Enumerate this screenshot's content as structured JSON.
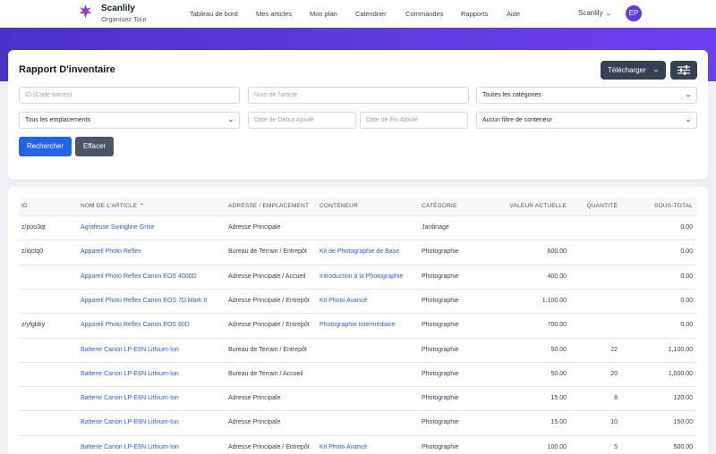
{
  "nav": {
    "brand_name": "Scanlily",
    "brand_subtitle": "Organisez Tout",
    "items": [
      {
        "label": "Tableau de bord"
      },
      {
        "label": "Mes articles"
      },
      {
        "label": "Mon plan"
      },
      {
        "label": "Calendrier"
      },
      {
        "label": "Commandes"
      },
      {
        "label": "Rapports"
      },
      {
        "label": "Aide"
      }
    ],
    "user_name": "Scanlily",
    "avatar_initials": "EP"
  },
  "colors": {
    "accent": "#2563eb",
    "band_gradient": [
      "#4b33c8",
      "#6a3ff0"
    ],
    "dark_button": "#374151"
  },
  "report": {
    "title": "Rapport D'inventaire",
    "download_label": "Télécharger",
    "filters_icon": "sliders-icon",
    "filters": {
      "id_placeholder": "ID (Code-barres)",
      "name_placeholder": "Nom de l'article",
      "category_value": "Toutes les catégories",
      "location_value": "Tous les emplacements",
      "start_date_placeholder": "Date de Début Ajouté",
      "end_date_placeholder": "Date de Fin Ajouté",
      "container_value": "Aucun filtre de conteneur"
    },
    "search_label": "Rechercher",
    "clear_label": "Effacer"
  },
  "table": {
    "headers": {
      "id": "ID",
      "name": "NOM DE L'ARTICLE",
      "address": "ADRESSE / EMPLACEMENT",
      "container": "CONTENEUR",
      "category": "CATÉGORIE",
      "value": "VALEUR ACTUELLE",
      "quantity": "QUANTITÉ",
      "subtotal": "SOUS-TOTAL"
    },
    "sort_column": "name",
    "rows": [
      {
        "id": "z/poo3qt",
        "name": "Agrafeuse Swingline Grise",
        "address": "Adresse Principale",
        "container": "",
        "category": "Jardinage",
        "value": "",
        "quantity": "",
        "subtotal": "0.00"
      },
      {
        "id": "z/iqctq0",
        "name": "Appareil Photo Reflex",
        "address": "Bureau de Terrain / Entrepôt",
        "container": "Kit de Photographie de Base",
        "category": "Photographie",
        "value": "600.00",
        "quantity": "",
        "subtotal": "0.00"
      },
      {
        "id": "",
        "name": "Appareil Photo Reflex Canon EOS 4000D",
        "address": "Adresse Principale / Accueil",
        "container": "Introduction à la Photographie",
        "category": "Photographie",
        "value": "400.00",
        "quantity": "",
        "subtotal": "0.00"
      },
      {
        "id": "",
        "name": "Appareil Photo Reflex Canon EOS 7D Mark II",
        "address": "Adresse Principale / Entrepôt",
        "container": "Kit Photo Avancé",
        "category": "Photographie",
        "value": "1,100.00",
        "quantity": "",
        "subtotal": "0.00"
      },
      {
        "id": "z/yfgbby",
        "name": "Appareil Photo Reflex Canon EOS 80D",
        "address": "Adresse Principale / Entrepôt",
        "container": "Photographie Intermédiaire",
        "category": "Photographie",
        "value": "700.00",
        "quantity": "",
        "subtotal": "0.00"
      },
      {
        "id": "",
        "name": "Batterie Canon LP-E6N Lithium-Ion",
        "address": "Bureau de Terrain / Entrepôt",
        "container": "",
        "category": "Photographie",
        "value": "50.00",
        "quantity": "22",
        "subtotal": "1,100.00"
      },
      {
        "id": "",
        "name": "Batterie Canon LP-E6N Lithium-Ion",
        "address": "Bureau de Terrain / Accueil",
        "container": "",
        "category": "Photographie",
        "value": "50.00",
        "quantity": "20",
        "subtotal": "1,000.00"
      },
      {
        "id": "",
        "name": "Batterie Canon LP-E6N Lithium-Ion",
        "address": "Adresse Principale",
        "container": "",
        "category": "Photographie",
        "value": "15.00",
        "quantity": "8",
        "subtotal": "120.00"
      },
      {
        "id": "",
        "name": "Batterie Canon LP-E6N Lithium-Ion",
        "address": "Adresse Principale",
        "container": "",
        "category": "Photographie",
        "value": "15.00",
        "quantity": "10",
        "subtotal": "150.00"
      },
      {
        "id": "",
        "name": "Batterie Canon LP-E6N Lithium-Ion",
        "address": "Adresse Principale / Entrepôt",
        "container": "Kit Photo Avancé",
        "category": "Photographie",
        "value": "100.00",
        "quantity": "5",
        "subtotal": "500.00"
      }
    ]
  }
}
